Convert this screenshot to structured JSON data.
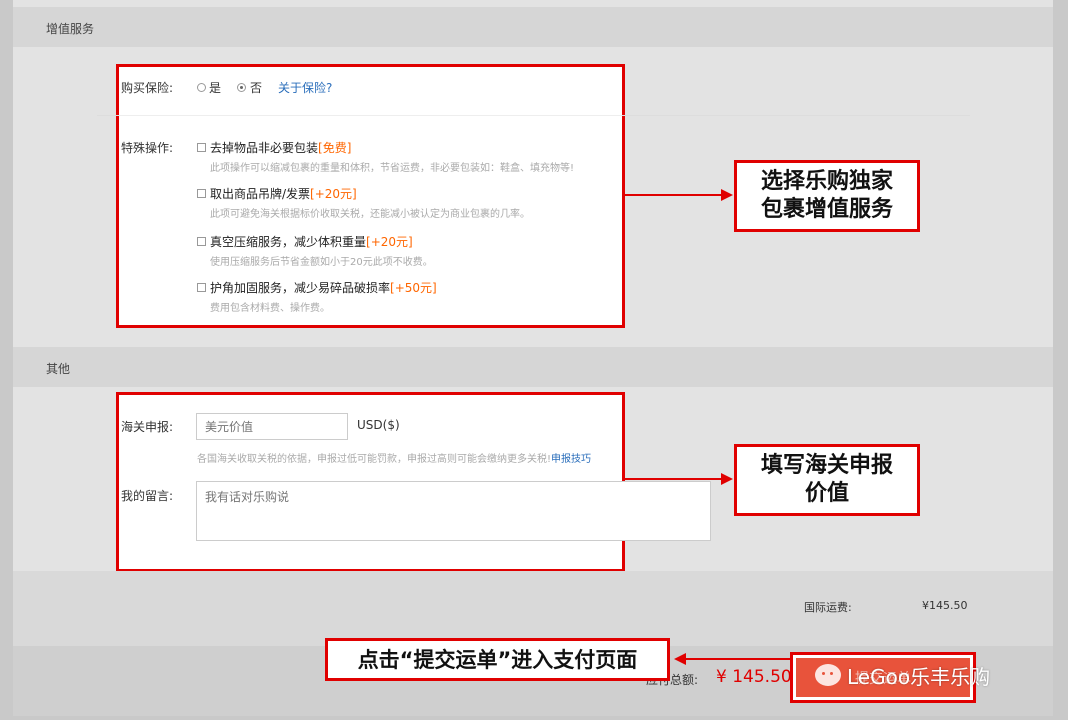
{
  "value_added": {
    "section_title": "增值服务",
    "insurance": {
      "label": "购买保险:",
      "options": [
        "是",
        "否"
      ],
      "selected": "否",
      "link": "关于保险?"
    },
    "special": {
      "label": "特殊操作:",
      "options": [
        {
          "title": "去掉物品非必要包装",
          "price": "[免费]",
          "desc": "此项操作可以缩减包裹的重量和体积，节省运费，非必要包装如：鞋盒、填充物等!"
        },
        {
          "title": "取出商品吊牌/发票",
          "price": "[+20元]",
          "desc": "此项可避免海关根据标价收取关税，还能减小被认定为商业包裹的几率。"
        },
        {
          "title": "真空压缩服务，减少体积重量",
          "price": "[+20元]",
          "desc": "使用压缩服务后节省金额如小于20元此项不收费。"
        },
        {
          "title": "护角加固服务，减少易碎品破损率",
          "price": "[+50元]",
          "desc": "费用包含材料费、操作费。"
        }
      ]
    }
  },
  "other": {
    "section_title": "其他",
    "customs": {
      "label": "海关申报:",
      "placeholder": "美元价值",
      "unit": "USD($)",
      "hint": "各国海关收取关税的依据，申报过低可能罚款，申报过高则可能会缴纳更多关税!",
      "hint_link": "申报技巧"
    },
    "message": {
      "label": "我的留言:",
      "placeholder": "我有话对乐购说"
    }
  },
  "summary": {
    "shipping_label": "国际运费:",
    "shipping_value": "¥145.50",
    "total_label": "应付总额:",
    "total_value": "¥ 145.50",
    "submit_label": "提交运单"
  },
  "callouts": {
    "value_added": "选择乐购独家包裹增值服务",
    "customs": "填写海关申报价值",
    "submit": "点击“提交运单”进入支付页面"
  },
  "watermark": "LeGoo乐丰乐购",
  "colors": {
    "accent_red": "#e00000",
    "price_orange": "#ff6600",
    "button_red": "#e8533b",
    "link_blue": "#2a6ebb"
  }
}
